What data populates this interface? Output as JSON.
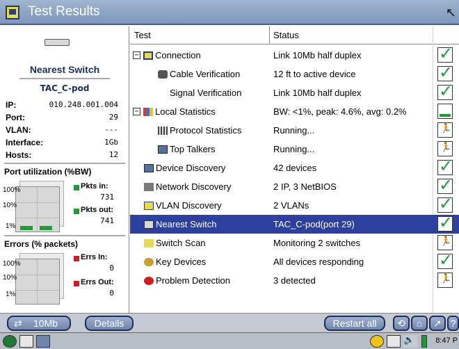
{
  "window": {
    "title": "Test Results"
  },
  "device": {
    "heading": "Nearest Switch",
    "name": "TAC_C-pod",
    "fields": [
      {
        "label": "IP:",
        "value": "010.248.001.004"
      },
      {
        "label": "Port:",
        "value": "29"
      },
      {
        "label": "VLAN:",
        "value": "---"
      },
      {
        "label": "Interface:",
        "value": "1Gb"
      },
      {
        "label": "Hosts:",
        "value": "12"
      }
    ]
  },
  "port_utilization": {
    "title": "Port utilization (%BW)",
    "axis": [
      "100%",
      "10%",
      "1%"
    ],
    "pkts_in_label": "Pkts in:",
    "pkts_in_value": "731",
    "pkts_out_label": "Pkts out:",
    "pkts_out_value": "741",
    "legend_color": "#1f9a3a"
  },
  "errors": {
    "title": "Errors (% packets)",
    "axis": [
      "100%",
      "10%",
      "1%"
    ],
    "errs_in_label": "Errs In:",
    "errs_in_value": "0",
    "errs_out_label": "Errs Out:",
    "errs_out_value": "0",
    "legend_color": "#cc1f1f"
  },
  "table": {
    "headers": {
      "test": "Test",
      "status": "Status"
    },
    "rows": [
      {
        "test": "Connection",
        "status": "Link 10Mb half duplex",
        "icon": "connection-icon",
        "expander": "−",
        "result": "ok"
      },
      {
        "test": "Cable Verification",
        "status": "12 ft to active device",
        "icon": "cable-icon",
        "result": "ok"
      },
      {
        "test": "Signal Verification",
        "status": "Link 10Mb half duplex",
        "icon": "signal-icon",
        "result": "ok"
      },
      {
        "test": "Local Statistics",
        "status": "BW: <1%, peak: 4.6%, avg: 0.2%",
        "icon": "statistics-icon",
        "expander": "−",
        "result": "bar"
      },
      {
        "test": "Protocol Statistics",
        "status": "Running...",
        "icon": "protocol-icon",
        "result": "run"
      },
      {
        "test": "Top Talkers",
        "status": "Running...",
        "icon": "computer-icon",
        "result": "run"
      },
      {
        "test": "Device Discovery",
        "status": "42 devices",
        "icon": "computer-icon",
        "result": "ok"
      },
      {
        "test": "Network Discovery",
        "status": "2 IP, 3 NetBIOS",
        "icon": "network-icon",
        "result": "ok"
      },
      {
        "test": "VLAN Discovery",
        "status": "2 VLANs",
        "icon": "vlan-icon",
        "result": "ok"
      },
      {
        "test": "Nearest Switch",
        "status": "TAC_C-pod(port 29)",
        "icon": "switch-icon",
        "result": "ok",
        "selected": true
      },
      {
        "test": "Switch Scan",
        "status": "Monitoring 2 switches",
        "icon": "scan-icon",
        "result": "run"
      },
      {
        "test": "Key Devices",
        "status": "All devices responding",
        "icon": "key-icon",
        "result": "ok"
      },
      {
        "test": "Problem Detection",
        "status": "3 detected",
        "icon": "problem-icon",
        "result": "run"
      }
    ]
  },
  "toolbar": {
    "speed_label": "10Mb",
    "details_label": "Details",
    "restart_label": "Restart all"
  },
  "taskbar": {
    "clock": "8:47 P"
  },
  "colors": {
    "selection": "#2d3f9f",
    "ok": "#1f9a3a",
    "title_bar": "#8ea3c5"
  }
}
